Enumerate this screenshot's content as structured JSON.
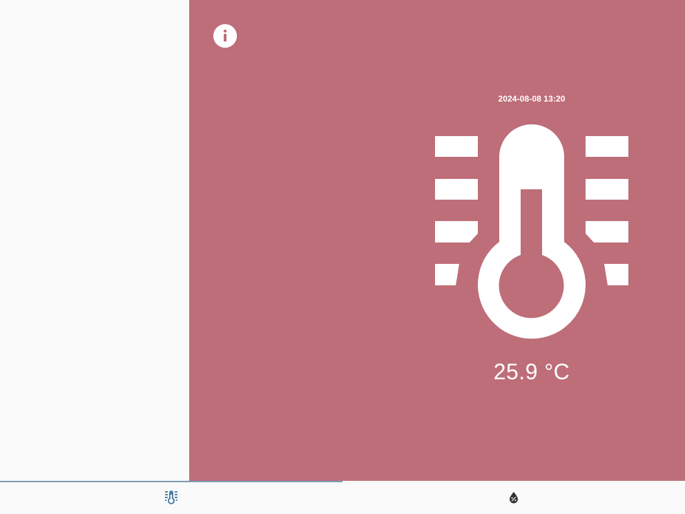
{
  "colors": {
    "accent": "#be6e79",
    "surface": "#fafafa",
    "active_tab_indicator": "#7a98b3",
    "icon_active": "#4f7ea5",
    "icon_inactive": "#333333"
  },
  "toolbar": {
    "info_icon": "info-icon"
  },
  "sensor": {
    "timestamp": "2024-08-08 13:20",
    "icon": "thermometer-icon",
    "reading": "25.9 °C"
  },
  "bottom_nav": {
    "tabs": [
      {
        "icon": "thermometer-icon",
        "active": true
      },
      {
        "icon": "humidity-icon",
        "active": false
      }
    ]
  }
}
